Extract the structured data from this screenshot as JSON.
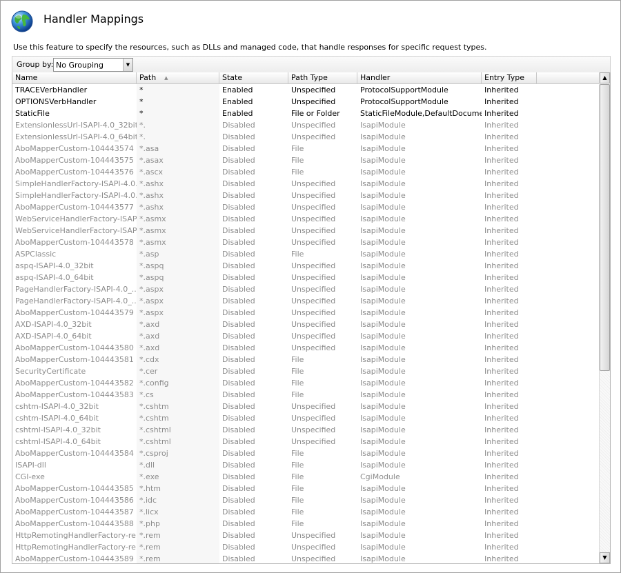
{
  "header": {
    "title": "Handler Mappings",
    "icon": "globe-icon"
  },
  "description": "Use this feature to specify the resources, such as DLLs and managed code, that handle responses for specific request types.",
  "groupby": {
    "label": "Group by:",
    "value": "No Grouping"
  },
  "columns": [
    "Name",
    "Path",
    "State",
    "Path Type",
    "Handler",
    "Entry Type"
  ],
  "rows": [
    [
      "TRACEVerbHandler",
      "*",
      "Enabled",
      "Unspecified",
      "ProtocolSupportModule",
      "Inherited"
    ],
    [
      "OPTIONSVerbHandler",
      "*",
      "Enabled",
      "Unspecified",
      "ProtocolSupportModule",
      "Inherited"
    ],
    [
      "StaticFile",
      "*",
      "Enabled",
      "File or Folder",
      "StaticFileModule,DefaultDocume...",
      "Inherited"
    ],
    [
      "ExtensionlessUrl-ISAPI-4.0_32bit",
      "*.",
      "Disabled",
      "Unspecified",
      "IsapiModule",
      "Inherited"
    ],
    [
      "ExtensionlessUrl-ISAPI-4.0_64bit",
      "*.",
      "Disabled",
      "Unspecified",
      "IsapiModule",
      "Inherited"
    ],
    [
      "AboMapperCustom-104443574",
      "*.asa",
      "Disabled",
      "File",
      "IsapiModule",
      "Inherited"
    ],
    [
      "AboMapperCustom-104443575",
      "*.asax",
      "Disabled",
      "File",
      "IsapiModule",
      "Inherited"
    ],
    [
      "AboMapperCustom-104443576",
      "*.ascx",
      "Disabled",
      "File",
      "IsapiModule",
      "Inherited"
    ],
    [
      "SimpleHandlerFactory-ISAPI-4.0...",
      "*.ashx",
      "Disabled",
      "Unspecified",
      "IsapiModule",
      "Inherited"
    ],
    [
      "SimpleHandlerFactory-ISAPI-4.0...",
      "*.ashx",
      "Disabled",
      "Unspecified",
      "IsapiModule",
      "Inherited"
    ],
    [
      "AboMapperCustom-104443577",
      "*.ashx",
      "Disabled",
      "Unspecified",
      "IsapiModule",
      "Inherited"
    ],
    [
      "WebServiceHandlerFactory-ISAP...",
      "*.asmx",
      "Disabled",
      "Unspecified",
      "IsapiModule",
      "Inherited"
    ],
    [
      "WebServiceHandlerFactory-ISAP...",
      "*.asmx",
      "Disabled",
      "Unspecified",
      "IsapiModule",
      "Inherited"
    ],
    [
      "AboMapperCustom-104443578",
      "*.asmx",
      "Disabled",
      "Unspecified",
      "IsapiModule",
      "Inherited"
    ],
    [
      "ASPClassic",
      "*.asp",
      "Disabled",
      "File",
      "IsapiModule",
      "Inherited"
    ],
    [
      "aspq-ISAPI-4.0_32bit",
      "*.aspq",
      "Disabled",
      "Unspecified",
      "IsapiModule",
      "Inherited"
    ],
    [
      "aspq-ISAPI-4.0_64bit",
      "*.aspq",
      "Disabled",
      "Unspecified",
      "IsapiModule",
      "Inherited"
    ],
    [
      "PageHandlerFactory-ISAPI-4.0_...",
      "*.aspx",
      "Disabled",
      "Unspecified",
      "IsapiModule",
      "Inherited"
    ],
    [
      "PageHandlerFactory-ISAPI-4.0_...",
      "*.aspx",
      "Disabled",
      "Unspecified",
      "IsapiModule",
      "Inherited"
    ],
    [
      "AboMapperCustom-104443579",
      "*.aspx",
      "Disabled",
      "Unspecified",
      "IsapiModule",
      "Inherited"
    ],
    [
      "AXD-ISAPI-4.0_32bit",
      "*.axd",
      "Disabled",
      "Unspecified",
      "IsapiModule",
      "Inherited"
    ],
    [
      "AXD-ISAPI-4.0_64bit",
      "*.axd",
      "Disabled",
      "Unspecified",
      "IsapiModule",
      "Inherited"
    ],
    [
      "AboMapperCustom-104443580",
      "*.axd",
      "Disabled",
      "Unspecified",
      "IsapiModule",
      "Inherited"
    ],
    [
      "AboMapperCustom-104443581",
      "*.cdx",
      "Disabled",
      "File",
      "IsapiModule",
      "Inherited"
    ],
    [
      "SecurityCertificate",
      "*.cer",
      "Disabled",
      "File",
      "IsapiModule",
      "Inherited"
    ],
    [
      "AboMapperCustom-104443582",
      "*.config",
      "Disabled",
      "File",
      "IsapiModule",
      "Inherited"
    ],
    [
      "AboMapperCustom-104443583",
      "*.cs",
      "Disabled",
      "File",
      "IsapiModule",
      "Inherited"
    ],
    [
      "cshtm-ISAPI-4.0_32bit",
      "*.cshtm",
      "Disabled",
      "Unspecified",
      "IsapiModule",
      "Inherited"
    ],
    [
      "cshtm-ISAPI-4.0_64bit",
      "*.cshtm",
      "Disabled",
      "Unspecified",
      "IsapiModule",
      "Inherited"
    ],
    [
      "cshtml-ISAPI-4.0_32bit",
      "*.cshtml",
      "Disabled",
      "Unspecified",
      "IsapiModule",
      "Inherited"
    ],
    [
      "cshtml-ISAPI-4.0_64bit",
      "*.cshtml",
      "Disabled",
      "Unspecified",
      "IsapiModule",
      "Inherited"
    ],
    [
      "AboMapperCustom-104443584",
      "*.csproj",
      "Disabled",
      "File",
      "IsapiModule",
      "Inherited"
    ],
    [
      "ISAPI-dll",
      "*.dll",
      "Disabled",
      "File",
      "IsapiModule",
      "Inherited"
    ],
    [
      "CGI-exe",
      "*.exe",
      "Disabled",
      "File",
      "CgiModule",
      "Inherited"
    ],
    [
      "AboMapperCustom-104443585",
      "*.htm",
      "Disabled",
      "File",
      "IsapiModule",
      "Inherited"
    ],
    [
      "AboMapperCustom-104443586",
      "*.idc",
      "Disabled",
      "File",
      "IsapiModule",
      "Inherited"
    ],
    [
      "AboMapperCustom-104443587",
      "*.licx",
      "Disabled",
      "File",
      "IsapiModule",
      "Inherited"
    ],
    [
      "AboMapperCustom-104443588",
      "*.php",
      "Disabled",
      "File",
      "IsapiModule",
      "Inherited"
    ],
    [
      "HttpRemotingHandlerFactory-re...",
      "*.rem",
      "Disabled",
      "Unspecified",
      "IsapiModule",
      "Inherited"
    ],
    [
      "HttpRemotingHandlerFactory-re...",
      "*.rem",
      "Disabled",
      "Unspecified",
      "IsapiModule",
      "Inherited"
    ],
    [
      "AboMapperCustom-104443589",
      "*.rem",
      "Disabled",
      "Unspecified",
      "IsapiModule",
      "Inherited"
    ]
  ],
  "colors": {
    "enabled_text": "#000000",
    "disabled_text": "#8c8c8c"
  }
}
